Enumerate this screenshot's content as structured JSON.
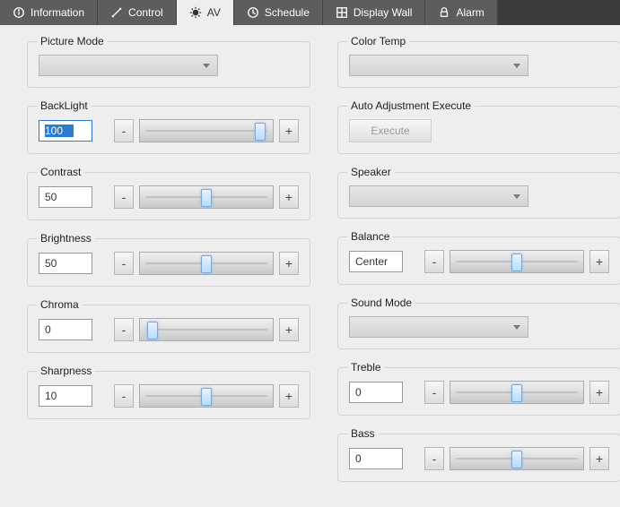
{
  "tabs": {
    "information": "Information",
    "control": "Control",
    "av": "AV",
    "schedule": "Schedule",
    "display_wall": "Display Wall",
    "alarm": "Alarm"
  },
  "left": {
    "picture_mode": {
      "title": "Picture Mode"
    },
    "backlight": {
      "title": "BackLight",
      "value": "100",
      "pos": 98
    },
    "contrast": {
      "title": "Contrast",
      "value": "50",
      "pos": 50
    },
    "brightness": {
      "title": "Brightness",
      "value": "50",
      "pos": 50
    },
    "chroma": {
      "title": "Chroma",
      "value": "0",
      "pos": 2
    },
    "sharpness": {
      "title": "Sharpness",
      "value": "10",
      "pos": 50
    }
  },
  "right": {
    "color_temp": {
      "title": "Color Temp"
    },
    "auto_adj": {
      "title": "Auto Adjustment Execute",
      "button": "Execute"
    },
    "speaker": {
      "title": "Speaker"
    },
    "balance": {
      "title": "Balance",
      "value": "Center",
      "pos": 50
    },
    "sound_mode": {
      "title": "Sound Mode"
    },
    "treble": {
      "title": "Treble",
      "value": "0",
      "pos": 50
    },
    "bass": {
      "title": "Bass",
      "value": "0",
      "pos": 50
    }
  },
  "glyphs": {
    "minus": "-",
    "plus": "+"
  }
}
